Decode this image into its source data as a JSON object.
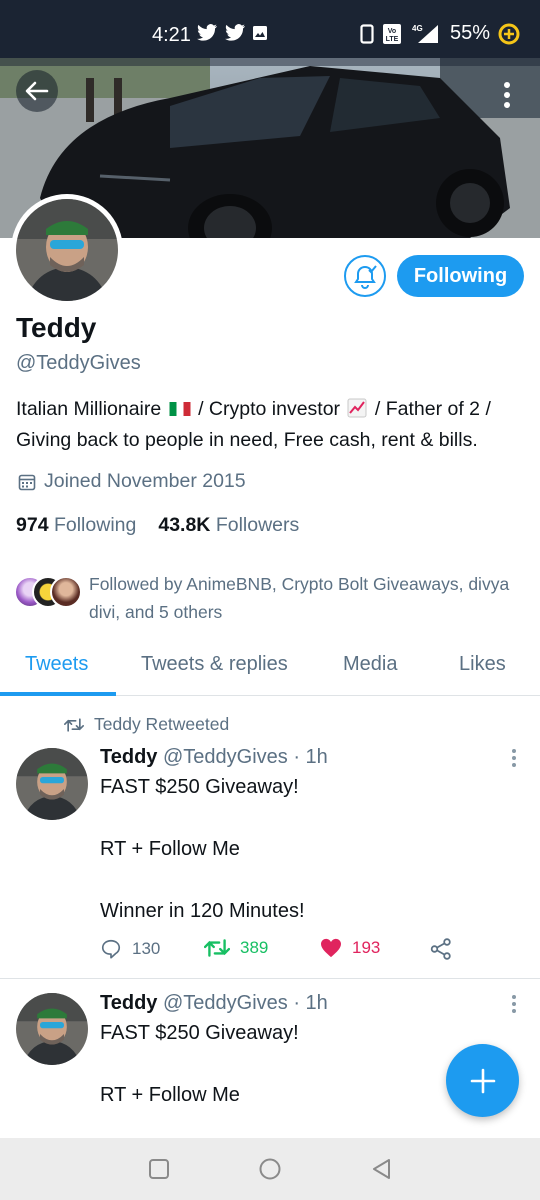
{
  "status_bar": {
    "time": "4:21",
    "battery": "55%",
    "network": "4G",
    "volte": "Vo LTE"
  },
  "profile": {
    "name": "Teddy",
    "handle": "@TeddyGives",
    "bio_part1": "Italian Millionaire",
    "bio_part2": "/ Crypto investor",
    "bio_part3": "/ Father of 2 / Giving back to people in need, Free cash, rent & bills.",
    "joined": "Joined November 2015",
    "following_count": "974",
    "following_label": "Following",
    "followers_count": "43.8K",
    "followers_label": "Followers",
    "followed_by": "Followed by AnimeBNB, Crypto Bolt Giveaways, divya divi, and 5 others",
    "follow_button": "Following"
  },
  "tabs": [
    {
      "label": "Tweets"
    },
    {
      "label": "Tweets & replies"
    },
    {
      "label": "Media"
    },
    {
      "label": "Likes"
    }
  ],
  "tweets": [
    {
      "retweet_label": "Teddy Retweeted",
      "name": "Teddy",
      "handle": "@TeddyGives · 1h",
      "line1": "FAST $250 Giveaway!",
      "line2": "RT + Follow Me",
      "line3": "Winner in 120 Minutes!",
      "replies": "130",
      "retweets": "389",
      "likes": "193"
    },
    {
      "name": "Teddy",
      "handle": "@TeddyGives · 1h",
      "line1": "FAST $250 Giveaway!",
      "line2": "RT + Follow Me"
    }
  ],
  "colors": {
    "accent": "#1d9bf0",
    "retweet": "#17bf63",
    "like": "#e0245e",
    "secondary_text": "#5b7083"
  }
}
